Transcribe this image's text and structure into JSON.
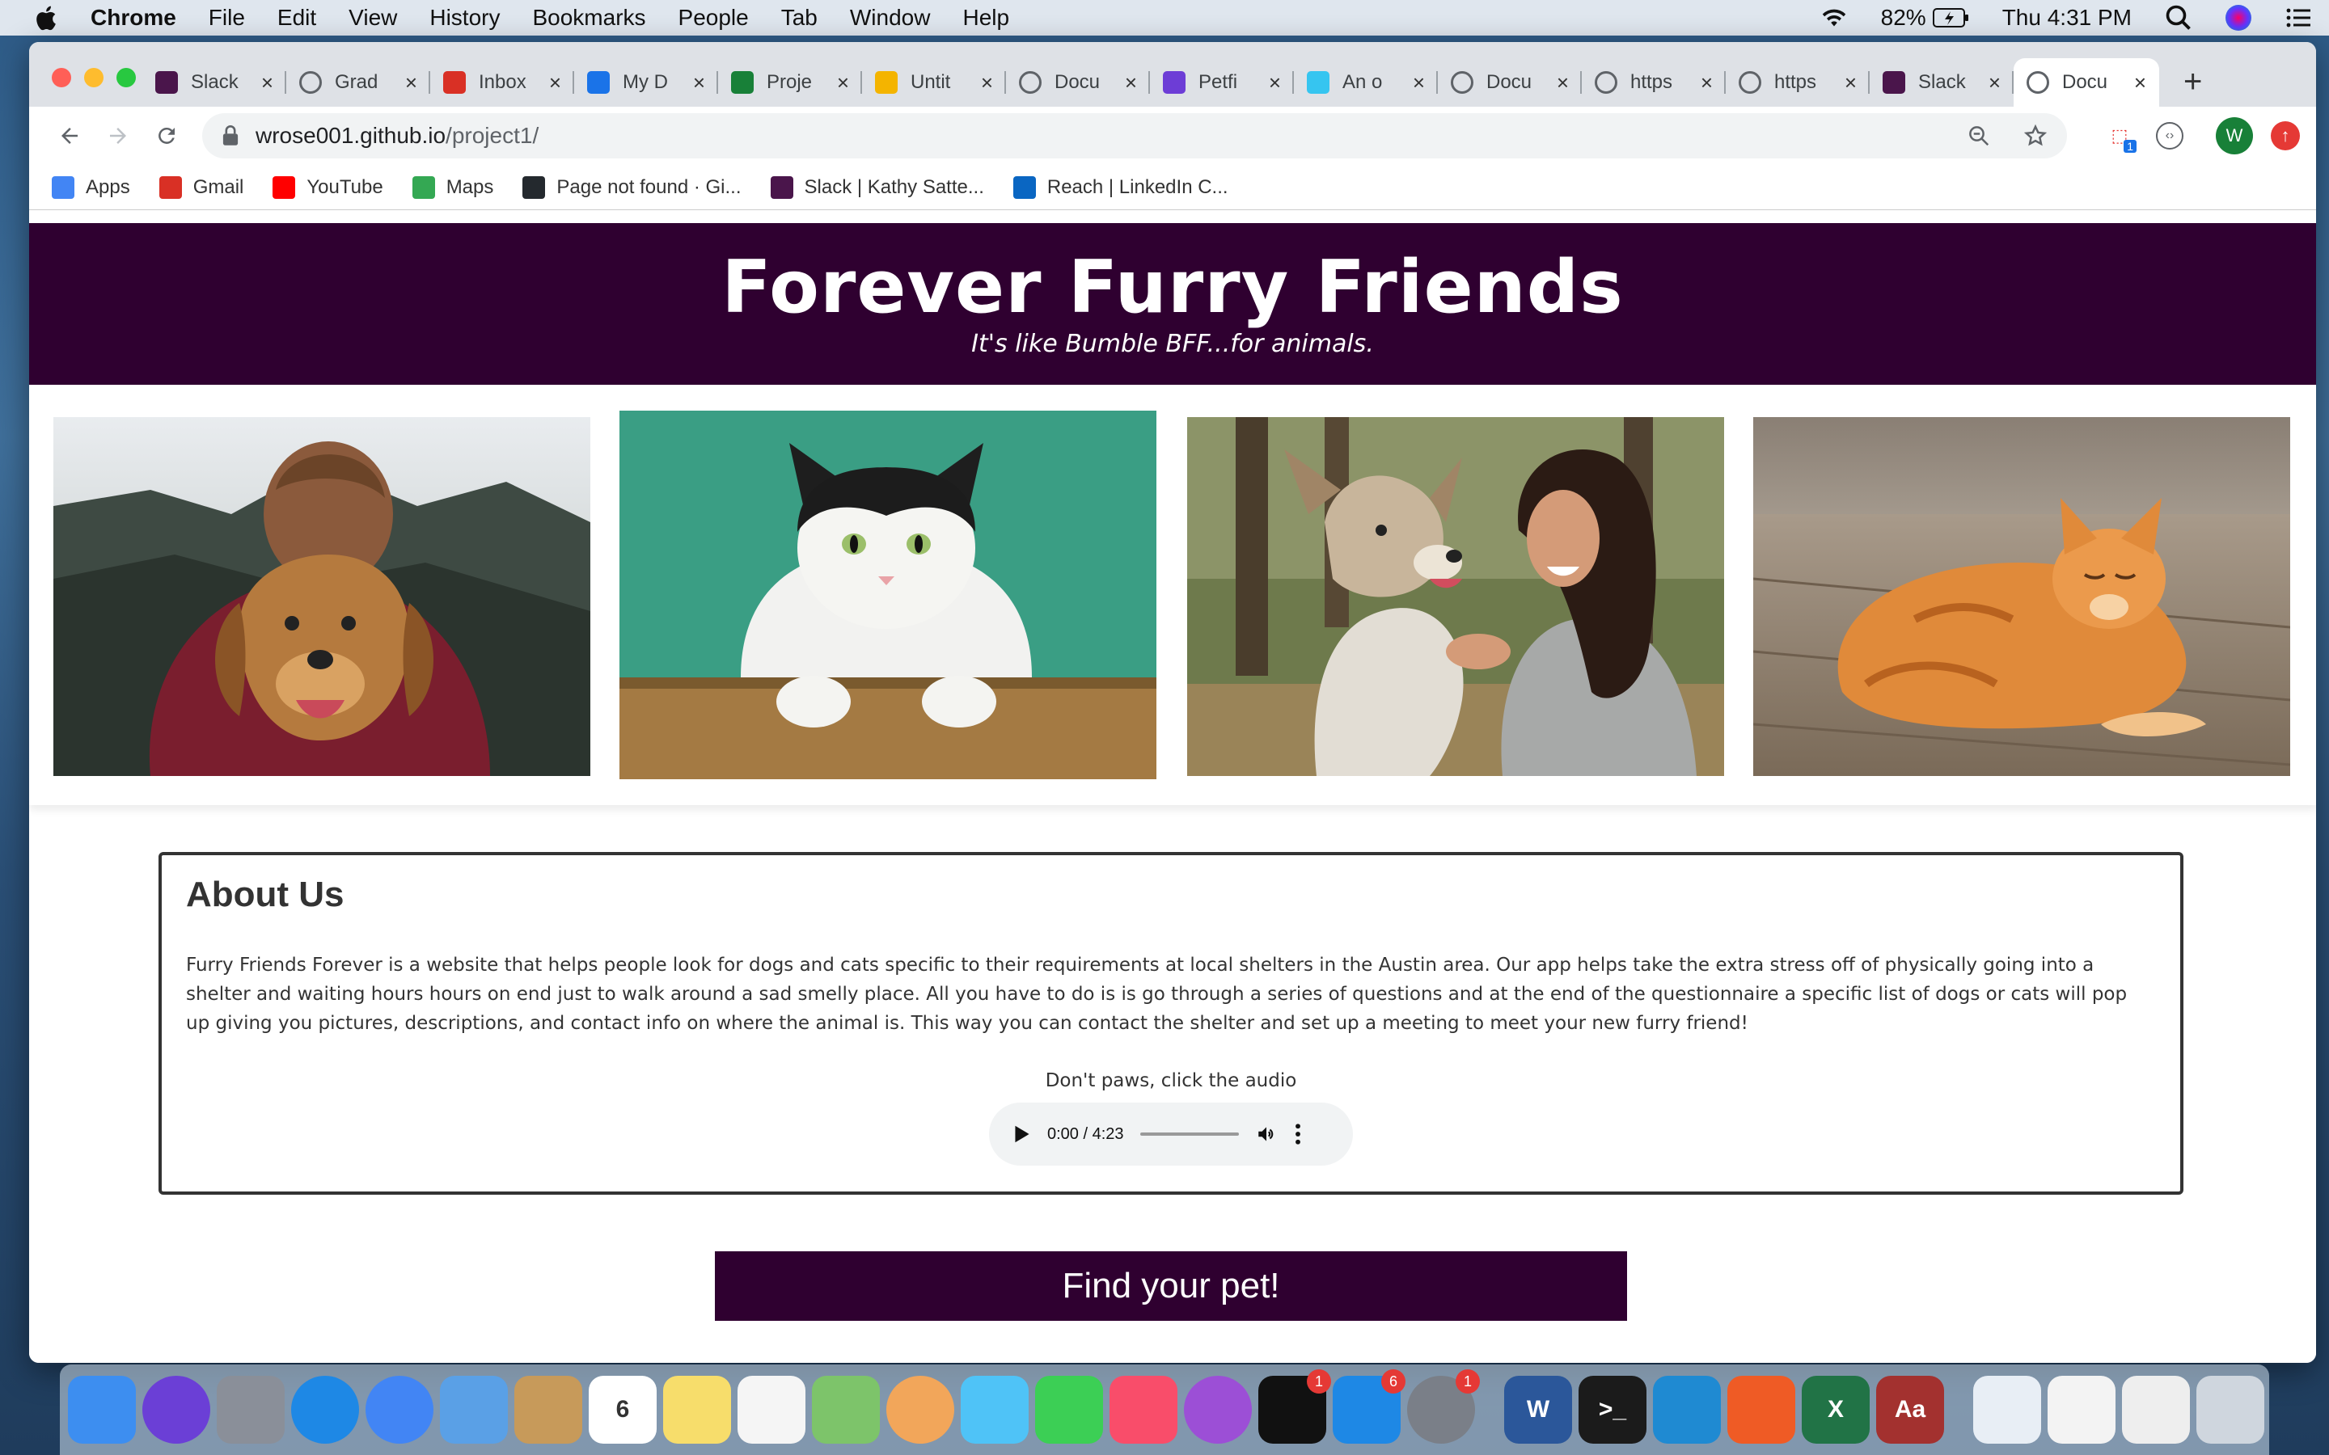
{
  "menubar": {
    "app": "Chrome",
    "items": [
      "File",
      "Edit",
      "View",
      "History",
      "Bookmarks",
      "People",
      "Tab",
      "Window",
      "Help"
    ],
    "battery": "82%",
    "clock": "Thu 4:31 PM"
  },
  "tabs": [
    {
      "label": "Slack",
      "icon": "slack-icon",
      "color": "#4a154b"
    },
    {
      "label": "Grad",
      "icon": "globe-icon",
      "color": "#5f6368"
    },
    {
      "label": "Inbox",
      "icon": "gmail-icon",
      "color": "#d93025"
    },
    {
      "label": "My D",
      "icon": "drive-icon",
      "color": "#1a73e8"
    },
    {
      "label": "Proje",
      "icon": "sheets-icon",
      "color": "#188038"
    },
    {
      "label": "Untit",
      "icon": "slides-icon",
      "color": "#f4b400"
    },
    {
      "label": "Docu",
      "icon": "globe-icon",
      "color": "#5f6368"
    },
    {
      "label": "Petfi",
      "icon": "petfinder-icon",
      "color": "#6d3dd6"
    },
    {
      "label": "An o",
      "icon": "slack-icon",
      "color": "#36c5f0"
    },
    {
      "label": "Docu",
      "icon": "globe-icon",
      "color": "#5f6368"
    },
    {
      "label": "https",
      "icon": "globe-icon",
      "color": "#5f6368"
    },
    {
      "label": "https",
      "icon": "globe-icon",
      "color": "#5f6368"
    },
    {
      "label": "Slack",
      "icon": "slack-icon",
      "color": "#4a154b"
    },
    {
      "label": "Docu",
      "icon": "globe-icon",
      "color": "#5f6368",
      "active": true
    }
  ],
  "toolbar": {
    "url_host": "wrose001.github.io",
    "url_path": "/project1/",
    "profile_initial": "W"
  },
  "bookmarks": [
    {
      "label": "Apps",
      "icon": "apps-grid-icon",
      "color": "#4285f4"
    },
    {
      "label": "Gmail",
      "icon": "gmail-icon",
      "color": "#d93025"
    },
    {
      "label": "YouTube",
      "icon": "youtube-icon",
      "color": "#ff0000"
    },
    {
      "label": "Maps",
      "icon": "maps-icon",
      "color": "#34a853"
    },
    {
      "label": "Page not found · Gi...",
      "icon": "github-icon",
      "color": "#24292e"
    },
    {
      "label": "Slack | Kathy Satte...",
      "icon": "slack-icon",
      "color": "#4a154b"
    },
    {
      "label": "Reach | LinkedIn C...",
      "icon": "linkedin-icon",
      "color": "#0a66c2"
    }
  ],
  "page": {
    "title": "Forever Furry Friends",
    "tagline": "It's like Bumble BFF...for animals.",
    "about_heading": "About Us",
    "about_text": "Furry Friends Forever is a website that helps people look for dogs and cats specific to their requirements at local shelters in the Austin area. Our app helps take the extra stress off of physically going into a shelter and waiting hours hours on end just to walk around a sad smelly place. All you have to do is is go through a series of questions and at the end of the questionnaire a specific list of dogs or cats will pop up giving you pictures, descriptions, and contact info on where the animal is. This way you can contact the shelter and set up a meeting to meet your new furry friend!",
    "audio_caption": "Don't paws, click the audio",
    "audio_time": "0:00 / 4:23",
    "cta_label": "Find your pet!",
    "brand_color": "#2f0030"
  },
  "dock": [
    {
      "name": "finder-icon",
      "color": "#3d8ef0"
    },
    {
      "name": "siri-icon",
      "color": "#6b3fd6"
    },
    {
      "name": "launchpad-icon",
      "color": "#8a8f99"
    },
    {
      "name": "safari-icon",
      "color": "#1e88e5"
    },
    {
      "name": "chrome-icon",
      "color": "#4285f4"
    },
    {
      "name": "mail-icon",
      "color": "#5aa0e6"
    },
    {
      "name": "contacts-icon",
      "color": "#c79a5a"
    },
    {
      "name": "calendar-icon",
      "color": "#ffffff",
      "text": "6"
    },
    {
      "name": "notes-icon",
      "color": "#f7dd6b"
    },
    {
      "name": "reminders-icon",
      "color": "#f5f5f5"
    },
    {
      "name": "maps-icon",
      "color": "#7dc46a"
    },
    {
      "name": "photos-icon",
      "color": "#f2a65a"
    },
    {
      "name": "messages-icon",
      "color": "#4fc3f7"
    },
    {
      "name": "facetime-icon",
      "color": "#3ccf55"
    },
    {
      "name": "music-icon",
      "color": "#f94d6a"
    },
    {
      "name": "podcasts-icon",
      "color": "#9c4fd6"
    },
    {
      "name": "apple-tv-icon",
      "color": "#111111",
      "badge": "1"
    },
    {
      "name": "app-store-icon",
      "color": "#1e88e5",
      "badge": "6"
    },
    {
      "name": "system-preferences-icon",
      "color": "#7a7f88",
      "badge": "1"
    },
    {
      "name": "separator"
    },
    {
      "name": "word-icon",
      "color": "#2b579a",
      "text": "W"
    },
    {
      "name": "terminal-icon",
      "color": "#1b1b1b",
      "text": ">_"
    },
    {
      "name": "vscode-icon",
      "color": "#1f8ad2"
    },
    {
      "name": "postman-icon",
      "color": "#ef5b25"
    },
    {
      "name": "excel-icon",
      "color": "#217346",
      "text": "X"
    },
    {
      "name": "dictionary-icon",
      "color": "#a3312f",
      "text": "Aa"
    },
    {
      "name": "separator"
    },
    {
      "name": "preview-icon",
      "color": "#e8eef5"
    },
    {
      "name": "calendar-doc-icon",
      "color": "#f3f3f3"
    },
    {
      "name": "screenshot-icon",
      "color": "#eeeeee"
    },
    {
      "name": "trash-icon",
      "color": "#cfd6de"
    }
  ]
}
